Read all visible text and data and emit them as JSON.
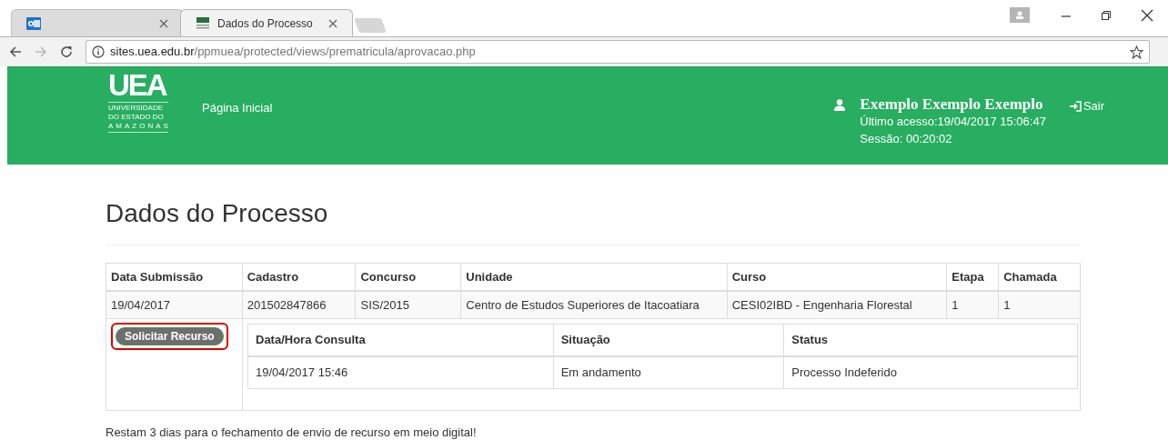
{
  "browser": {
    "tabs": [
      {
        "kind": "mail",
        "selected": false
      },
      {
        "kind": "site",
        "title": "Dados do Processo",
        "selected": true
      }
    ],
    "url_host": "sites.uea.edu.br",
    "url_path": "/ppmuea/protected/views/prematricula/aprovacao.php"
  },
  "header": {
    "logo": {
      "mark": "UEA",
      "lines": [
        "UNIVERSIDADE",
        "DO ESTADO DO",
        "AMAZONAS"
      ]
    },
    "nav": "Página Inicial",
    "user": "Exemplo Exemplo Exemplo",
    "last_access": "Último acesso:19/04/2017 15:06:47",
    "session": "Sessão: 00:20:02",
    "logout": "Sair"
  },
  "page_title": "Dados do Processo",
  "table": {
    "columns": [
      "Data Submissão",
      "Cadastro",
      "Concurso",
      "Unidade",
      "Curso",
      "Etapa",
      "Chamada"
    ],
    "rows": [
      [
        "19/04/2017",
        "201502847866",
        "SIS/2015",
        "Centro de Estudos Superiores de Itacoatiara",
        "CESI02IBD - Engenharia Florestal",
        "1",
        "1"
      ]
    ]
  },
  "appeal_button": {
    "label": "Solicitar Recurso",
    "highlighted": true
  },
  "history": {
    "columns": [
      "Data/Hora Consulta",
      "Situação",
      "Status"
    ],
    "rows": [
      [
        "19/04/2017 15:46",
        "Em andamento",
        "Processo Indeferido"
      ]
    ]
  },
  "notice": "Restam 3 dias para o fechamento de envio de recurso em meio digital!"
}
